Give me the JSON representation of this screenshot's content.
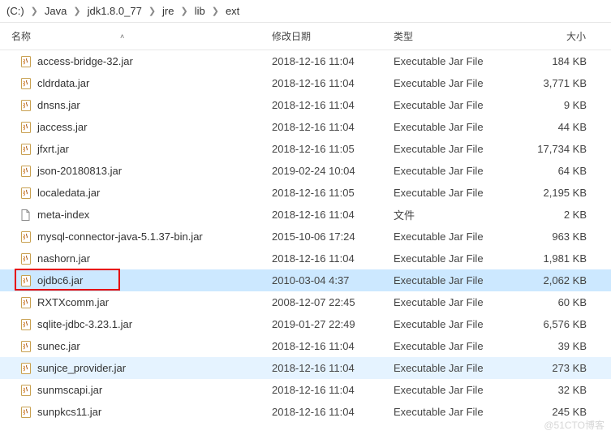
{
  "breadcrumb": {
    "segments": [
      "(C:)",
      "Java",
      "jdk1.8.0_77",
      "jre",
      "lib",
      "ext"
    ]
  },
  "columns": {
    "name": "名称",
    "date": "修改日期",
    "type": "类型",
    "size": "大小"
  },
  "files": [
    {
      "icon": "jar",
      "name": "access-bridge-32.jar",
      "date": "2018-12-16 11:04",
      "type": "Executable Jar File",
      "size": "184 KB"
    },
    {
      "icon": "jar",
      "name": "cldrdata.jar",
      "date": "2018-12-16 11:04",
      "type": "Executable Jar File",
      "size": "3,771 KB"
    },
    {
      "icon": "jar",
      "name": "dnsns.jar",
      "date": "2018-12-16 11:04",
      "type": "Executable Jar File",
      "size": "9 KB"
    },
    {
      "icon": "jar",
      "name": "jaccess.jar",
      "date": "2018-12-16 11:04",
      "type": "Executable Jar File",
      "size": "44 KB"
    },
    {
      "icon": "jar",
      "name": "jfxrt.jar",
      "date": "2018-12-16 11:05",
      "type": "Executable Jar File",
      "size": "17,734 KB"
    },
    {
      "icon": "jar",
      "name": "json-20180813.jar",
      "date": "2019-02-24 10:04",
      "type": "Executable Jar File",
      "size": "64 KB"
    },
    {
      "icon": "jar",
      "name": "localedata.jar",
      "date": "2018-12-16 11:05",
      "type": "Executable Jar File",
      "size": "2,195 KB"
    },
    {
      "icon": "file",
      "name": "meta-index",
      "date": "2018-12-16 11:04",
      "type": "文件",
      "size": "2 KB"
    },
    {
      "icon": "jar",
      "name": "mysql-connector-java-5.1.37-bin.jar",
      "date": "2015-10-06 17:24",
      "type": "Executable Jar File",
      "size": "963 KB"
    },
    {
      "icon": "jar",
      "name": "nashorn.jar",
      "date": "2018-12-16 11:04",
      "type": "Executable Jar File",
      "size": "1,981 KB"
    },
    {
      "icon": "jar",
      "name": "ojdbc6.jar",
      "date": "2010-03-04 4:37",
      "type": "Executable Jar File",
      "size": "2,062 KB",
      "state": "selected",
      "highlight_box": true
    },
    {
      "icon": "jar",
      "name": "RXTXcomm.jar",
      "date": "2008-12-07 22:45",
      "type": "Executable Jar File",
      "size": "60 KB"
    },
    {
      "icon": "jar",
      "name": "sqlite-jdbc-3.23.1.jar",
      "date": "2019-01-27 22:49",
      "type": "Executable Jar File",
      "size": "6,576 KB"
    },
    {
      "icon": "jar",
      "name": "sunec.jar",
      "date": "2018-12-16 11:04",
      "type": "Executable Jar File",
      "size": "39 KB"
    },
    {
      "icon": "jar",
      "name": "sunjce_provider.jar",
      "date": "2018-12-16 11:04",
      "type": "Executable Jar File",
      "size": "273 KB",
      "state": "hover"
    },
    {
      "icon": "jar",
      "name": "sunmscapi.jar",
      "date": "2018-12-16 11:04",
      "type": "Executable Jar File",
      "size": "32 KB"
    },
    {
      "icon": "jar",
      "name": "sunpkcs11.jar",
      "date": "2018-12-16 11:04",
      "type": "Executable Jar File",
      "size": "245 KB"
    }
  ],
  "watermark": "@51CTO博客"
}
